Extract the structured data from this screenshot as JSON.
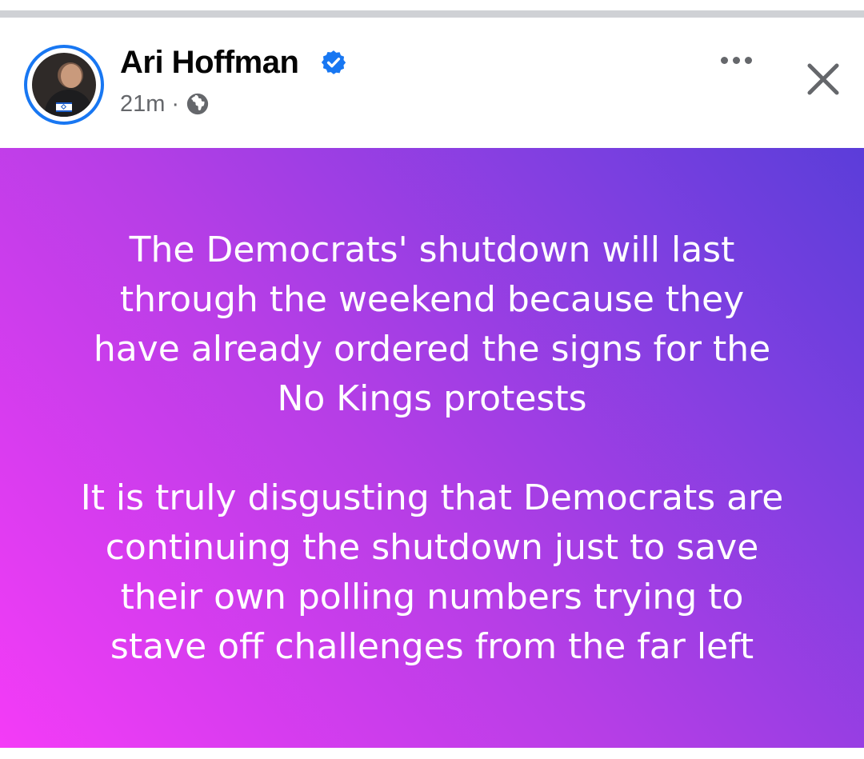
{
  "post": {
    "author": {
      "name": "Ari Hoffman",
      "verified": true,
      "avatar": "profile-photo-with-israel-flag"
    },
    "meta": {
      "time": "21m",
      "separator": "·",
      "audience_icon": "globe-icon"
    },
    "actions": {
      "more_icon": "more-options-icon",
      "close_icon": "close-icon"
    },
    "background": {
      "gradient_colors": [
        "#f43bf7",
        "#b63ee6",
        "#7b3fe0",
        "#5b3dd9"
      ],
      "text_color": "#ffffff"
    },
    "text": {
      "paragraph_1": [
        "The Democrats' shutdown will last",
        "through the weekend because they",
        "have already ordered the signs for the",
        "No Kings protests"
      ],
      "paragraph_2": [
        "It is truly disgusting that Democrats are",
        "continuing the shutdown just to save",
        "their own polling numbers trying to",
        "stave off challenges from the far left"
      ]
    }
  },
  "colors": {
    "verified_badge": "#1877f2",
    "avatar_ring": "#1877f2",
    "meta_text": "#65676b",
    "name_text": "#050505"
  }
}
